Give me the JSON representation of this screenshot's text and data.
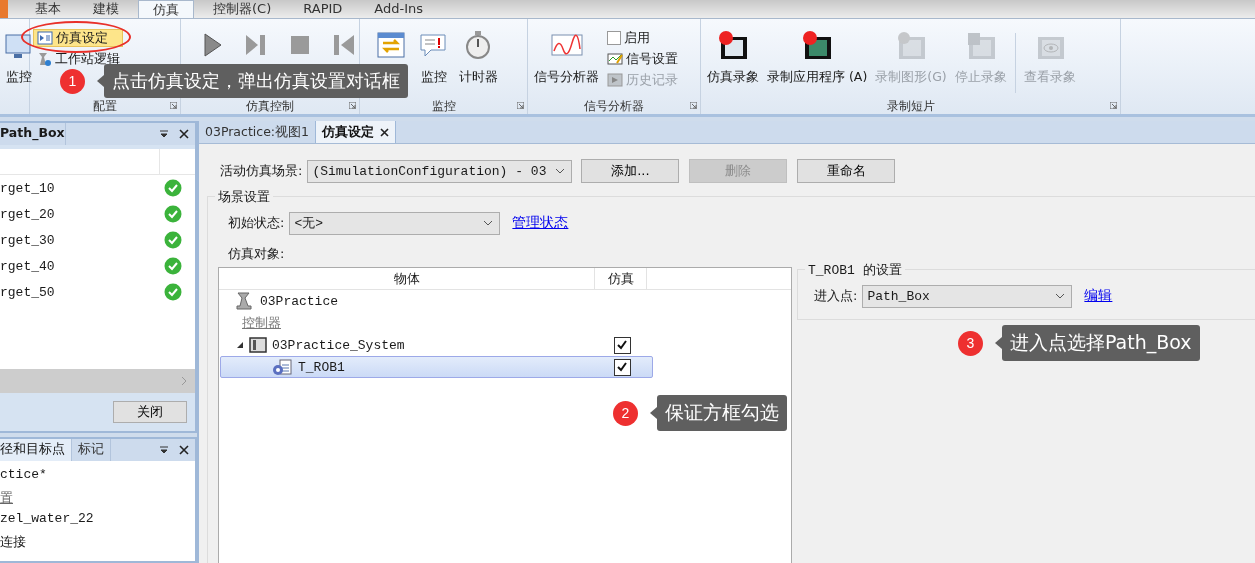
{
  "ribbon": {
    "tabs": [
      {
        "label": "基本",
        "selected": false
      },
      {
        "label": "建模",
        "selected": false
      },
      {
        "label": "仿真",
        "selected": true
      },
      {
        "label": "控制器(C)",
        "selected": false
      },
      {
        "label": "RAPID",
        "selected": false
      },
      {
        "label": "Add-Ins",
        "selected": false
      }
    ],
    "groups": [
      {
        "items": [
          {
            "kind": "large",
            "label": "监控",
            "disabled": false
          }
        ]
      },
      {
        "label": "配置",
        "items": [
          {
            "kind": "small",
            "label": "仿真设定",
            "selected": true,
            "disabled": false
          },
          {
            "kind": "small",
            "label": "工作站逻辑",
            "selected": false,
            "disabled": false
          }
        ]
      },
      {
        "label": "仿真控制",
        "items": [
          {
            "kind": "large",
            "disabled": false
          },
          {
            "kind": "large",
            "disabled": false
          },
          {
            "kind": "large",
            "disabled": false
          },
          {
            "kind": "large",
            "disabled": false
          }
        ]
      },
      {
        "label": "监控",
        "items": [
          {
            "kind": "large",
            "disabled": false
          },
          {
            "kind": "large",
            "label": "监控",
            "disabled": false
          },
          {
            "kind": "large",
            "label": "计时器",
            "disabled": false
          }
        ]
      },
      {
        "label": "信号分析器",
        "items": [
          {
            "kind": "large",
            "label": "信号分析器",
            "disabled": false
          },
          {
            "kind": "check",
            "label": "启用",
            "checked": false,
            "disabled": false
          },
          {
            "kind": "small",
            "label": "信号设置",
            "selected": false,
            "disabled": false
          },
          {
            "kind": "small",
            "label": "历史记录",
            "selected": false,
            "disabled": true
          }
        ]
      },
      {
        "label": "录制短片",
        "items": [
          {
            "kind": "large",
            "label": "仿真录象",
            "disabled": false
          },
          {
            "kind": "large",
            "label": "录制应用程序 (A)",
            "disabled": false
          },
          {
            "kind": "large",
            "label": "录制图形(G)",
            "disabled": true
          },
          {
            "kind": "large",
            "label": "停止录象",
            "disabled": true
          },
          {
            "kind": "separator"
          },
          {
            "kind": "large",
            "label": "查看录象",
            "disabled": true
          }
        ]
      }
    ]
  },
  "paths_panel": {
    "title": "Path_Box",
    "rows": [
      "rget_10",
      "rget_20",
      "rget_30",
      "rget_40",
      "rget_50"
    ],
    "close_button": "关闭"
  },
  "layout_panel": {
    "tabs": [
      {
        "label": "径和目标点",
        "selected": true
      },
      {
        "label": "标记",
        "selected": false
      }
    ],
    "rows": [
      {
        "label": "ctice*",
        "kind": "text"
      },
      {
        "label": "置",
        "kind": "link"
      },
      {
        "label": "zel_water_22",
        "kind": "text"
      },
      {
        "label": "连接",
        "kind": "text"
      }
    ]
  },
  "document_tabs": [
    {
      "label": "03Practice:视图1",
      "selected": false,
      "closable": false
    },
    {
      "label": "仿真设定",
      "selected": true,
      "closable": true
    }
  ],
  "sim_settings": {
    "scenario_label": "活动仿真场景:",
    "scenario_value": "(SimulationConfiguration) - 03",
    "buttons": [
      {
        "label": "添加...",
        "disabled": false
      },
      {
        "label": "删除",
        "disabled": true
      },
      {
        "label": "重命名",
        "disabled": false
      }
    ],
    "group_title": "场景设置",
    "initial_state_label": "初始状态:",
    "initial_state_value": "<无>",
    "manage_link": "管理状态",
    "objects_label": "仿真对象:",
    "columns": [
      "物体",
      "仿真"
    ],
    "tree": [
      {
        "label": "03Practice",
        "kind": "station"
      },
      {
        "label": "控制器",
        "kind": "category"
      },
      {
        "label": "03Practice_System",
        "kind": "system",
        "expanded": true,
        "checked": true,
        "selected": false,
        "children": [
          {
            "label": "T_ROB1",
            "kind": "task",
            "checked": true,
            "selected": true
          }
        ]
      }
    ],
    "task_group_title": "T_ROB1 的设置",
    "entry_label": "进入点:",
    "entry_value": "Path_Box",
    "edit_link": "编辑"
  },
  "callouts": [
    {
      "number": "1",
      "text": "点击仿真设定，弹出仿真设置对话框"
    },
    {
      "number": "2",
      "text": "保证方框勾选"
    },
    {
      "number": "3",
      "text": "进入点选择Path_Box"
    }
  ]
}
